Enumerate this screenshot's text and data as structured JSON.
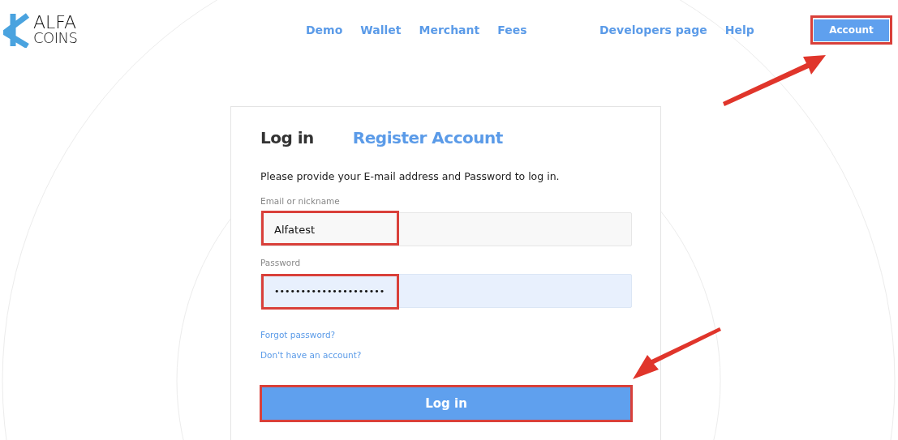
{
  "logo": {
    "line_1": "ALFA",
    "line_2": "COINS"
  },
  "nav": [
    {
      "label": "Demo"
    },
    {
      "label": "Wallet"
    },
    {
      "label": "Merchant"
    },
    {
      "label": "Fees"
    }
  ],
  "nav_secondary": [
    {
      "label": "Developers page"
    },
    {
      "label": "Help"
    }
  ],
  "account_button": {
    "label": "Account"
  },
  "tabs": [
    {
      "label": "Log in",
      "selected": true
    },
    {
      "label": "Register Account",
      "selected": false
    }
  ],
  "description": "Please provide your E-mail address and Password to log in.",
  "fields": [
    {
      "kind": "text",
      "label": "Email or nickname",
      "value": "Alfatest"
    },
    {
      "kind": "password",
      "label": "Password",
      "value": "•••••••••••••••••••••"
    }
  ],
  "links": [
    "Forgot password?",
    "Don't have an account?"
  ],
  "submit": {
    "label": "Log in"
  }
}
